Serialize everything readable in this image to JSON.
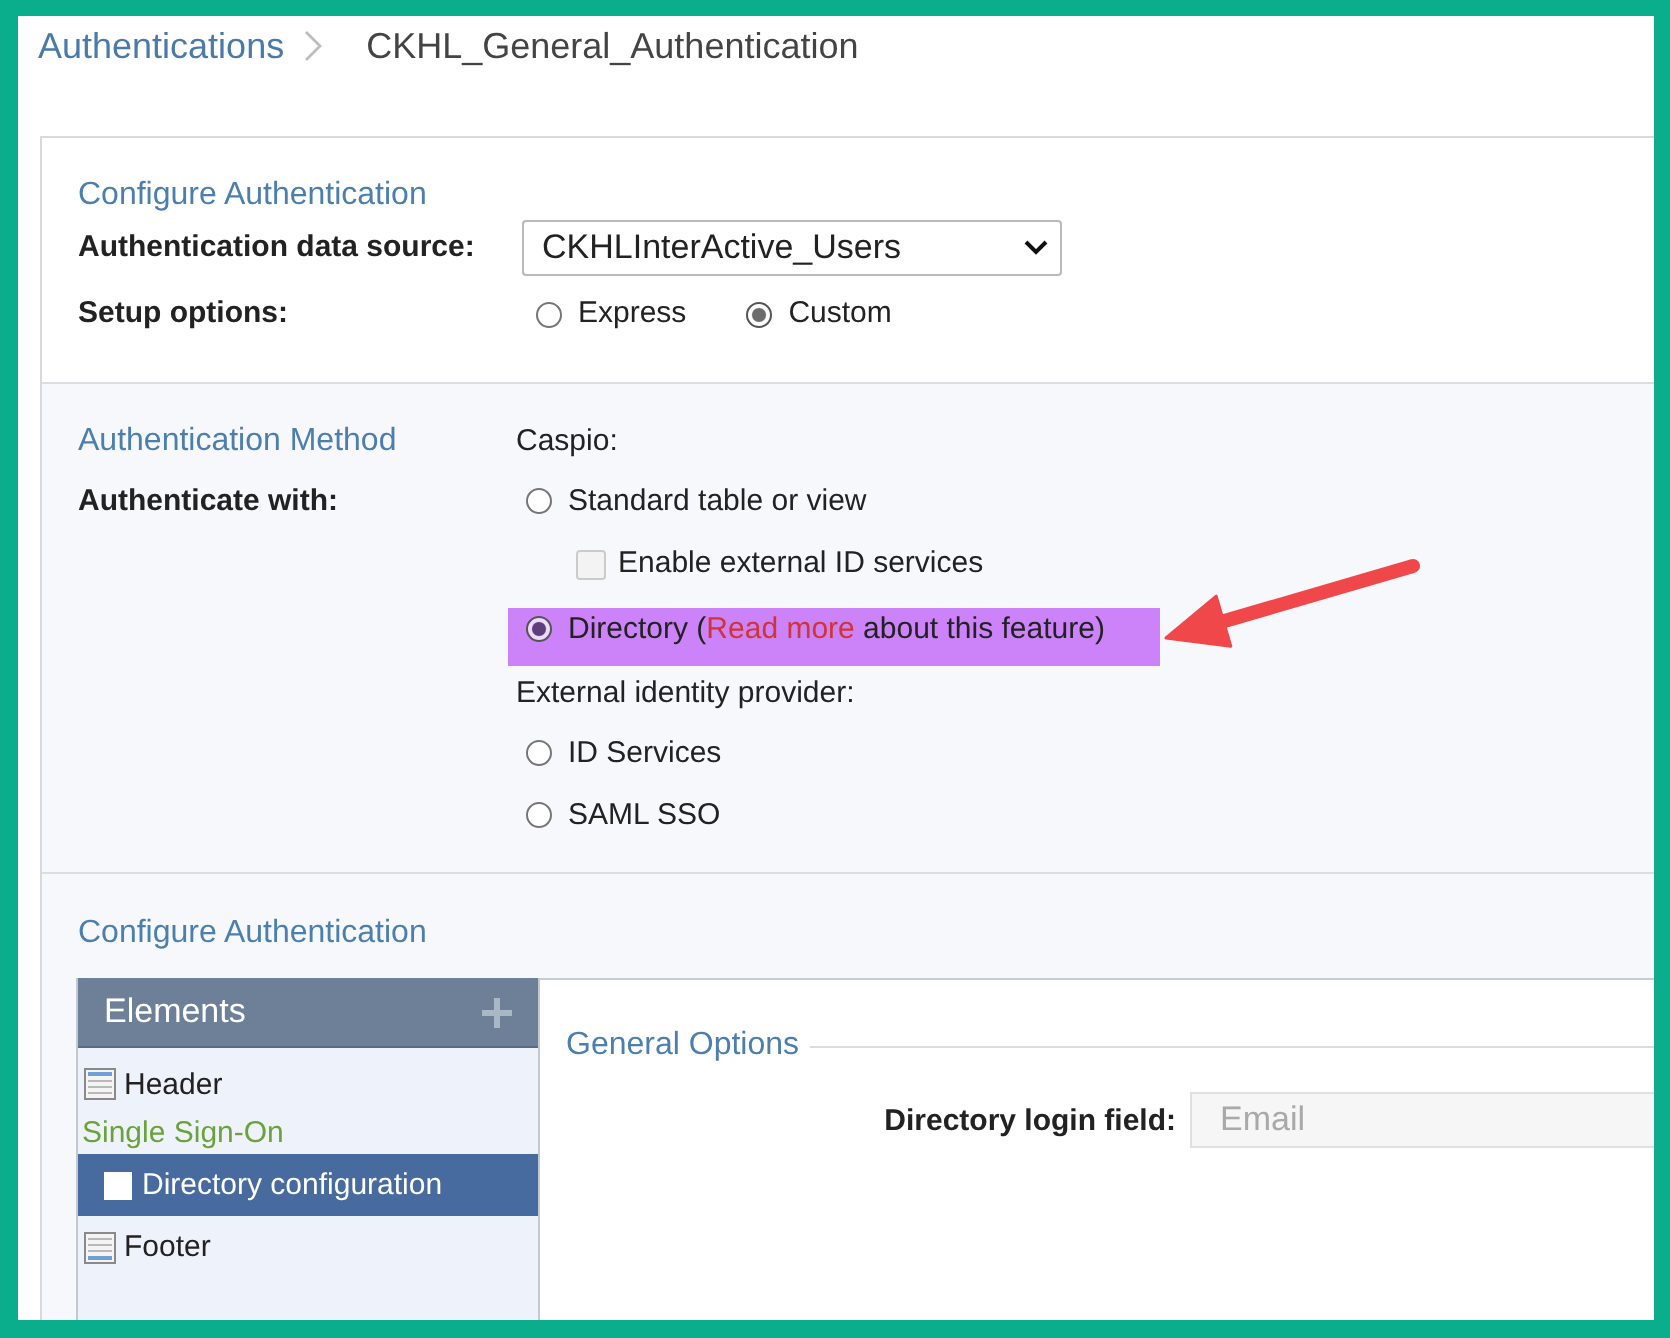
{
  "breadcrumb": [
    {
      "label": "Authentications",
      "kind": "link"
    },
    {
      "label": "CKHL_General_Authentication",
      "kind": "current"
    }
  ],
  "configure": {
    "title": "Configure Authentication",
    "data_source": {
      "label": "Authentication data source:",
      "value": "CKHLInterActive_Users"
    },
    "setup": {
      "label": "Setup options:",
      "options": [
        {
          "label": "Express",
          "selected": false
        },
        {
          "label": "Custom",
          "selected": true
        }
      ]
    }
  },
  "method": {
    "title": "Authentication Method",
    "label": "Authenticate with:",
    "rows": [
      {
        "kind": "heading",
        "label": "Caspio:"
      },
      {
        "kind": "radio",
        "label": "Standard table or view",
        "selected": false
      },
      {
        "kind": "checkbox",
        "label": "Enable external ID services",
        "checked": false,
        "disabled": true
      },
      {
        "kind": "radio",
        "label": "Directory (",
        "link": "Read more",
        "label_after": "about this feature)",
        "selected": true,
        "highlighted": true,
        "arrow": true
      },
      {
        "kind": "heading",
        "label": "External identity provider:"
      },
      {
        "kind": "radio",
        "label": "ID Services",
        "selected": false
      },
      {
        "kind": "radio",
        "label": "SAML SSO",
        "selected": false
      }
    ]
  },
  "design": {
    "title": "Configure Authentication",
    "elements": {
      "title": "Elements",
      "items": [
        {
          "kind": "header",
          "label": "Header",
          "selected": false
        },
        {
          "kind": "group",
          "label": "Single Sign-On",
          "selected": false
        },
        {
          "kind": "page",
          "label": "Directory configuration",
          "selected": true
        },
        {
          "kind": "footer",
          "label": "Footer",
          "selected": false
        }
      ]
    },
    "general_options": {
      "legend": "General Options",
      "fields": [
        {
          "label": "Directory login field:",
          "placeholder": "Email",
          "disabled": true
        }
      ]
    }
  }
}
